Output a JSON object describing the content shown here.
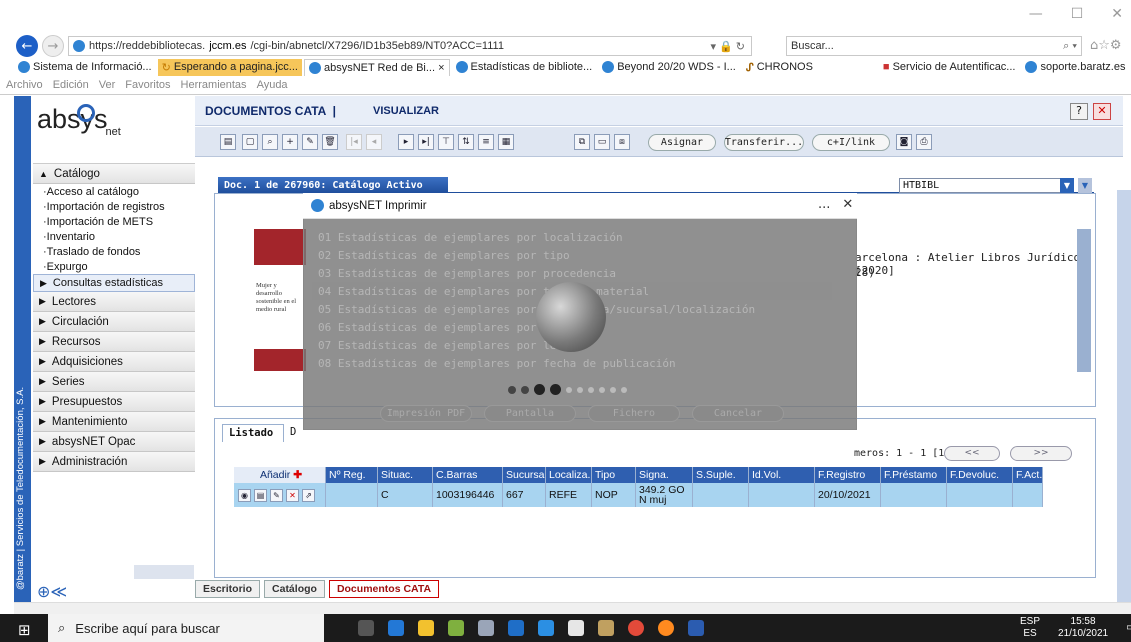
{
  "browser": {
    "url_prefix": "https://reddebibliotecas.",
    "url_domain": "jccm.es",
    "url_path": "/cgi-bin/abnetcl/X7296/ID1b35eb89/NT0?ACC=1111",
    "search_placeholder": "Buscar...",
    "tabs": [
      {
        "label": "Sistema de Informació..."
      },
      {
        "label": "Esperando a pagina.jcc..."
      },
      {
        "label": "absysNET Red de Bi... ×"
      },
      {
        "label": "Estadísticas de bibliote..."
      },
      {
        "label": "Beyond 20/20 WDS - I..."
      },
      {
        "label": "CHRONOS"
      },
      {
        "label": "Servicio de Autentificac..."
      },
      {
        "label": "soporte.baratz.es"
      }
    ],
    "menu": [
      "Archivo",
      "Edición",
      "Ver",
      "Favoritos",
      "Herramientas",
      "Ayuda"
    ]
  },
  "side_vertical_text": "@baratz | Servicios de Teledocumentación, S.A.",
  "logo": {
    "main": "absys",
    "sub": "net"
  },
  "menu": {
    "catalogo": "Catálogo",
    "catalogo_items": [
      "Acceso al catálogo",
      "Importación de registros",
      "Importación de METS",
      "Inventario",
      "Traslado de fondos",
      "Expurgo"
    ],
    "selected": "Consultas estadísticas",
    "sections": [
      "Lectores",
      "Circulación",
      "Recursos",
      "Adquisiciones",
      "Series",
      "Presupuestos",
      "Mantenimiento",
      "absysNET Opac",
      "Administración"
    ]
  },
  "header": {
    "title": "DOCUMENTOS CATA",
    "separator": "|",
    "visualizar": "VISUALIZAR",
    "help": "?",
    "close": "✕"
  },
  "toolbar": {
    "asignar": "Asignar",
    "transferir": "Transferir...",
    "link": "c+I/link"
  },
  "doc": {
    "bar": "Doc. 1 de 267960: Catálogo Activo",
    "db_select": "HTBIBL",
    "biblio_line1": "arcelona : Atelier Libros Jurídicos, [2020]",
    "biblio_line2": "28)",
    "cover_text": "Mujer y desarrollo sostenible en el medio rural"
  },
  "listado": {
    "tab": "Listado",
    "tab2": "D",
    "numeros": "meros: 1 - 1 [1]",
    "prev": "<<",
    "next": ">>",
    "add_label": "Añadir",
    "columns": [
      "Nº Reg.",
      "Situac.",
      "C.Barras",
      "Sucursal",
      "Localiza.",
      "Tipo",
      "Signa.",
      "S.Suple.",
      "Id.Vol.",
      "F.Registro",
      "F.Préstamo",
      "F.Devoluc.",
      "F.Act."
    ],
    "row": [
      "",
      "C",
      "1003196446",
      "667",
      "REFE",
      "NOP",
      "349.2 GO N muj",
      "",
      "",
      "20/10/2021",
      "",
      "",
      ""
    ]
  },
  "bottom_tabs": [
    "Escritorio",
    "Catálogo",
    "Documentos CATA"
  ],
  "modal": {
    "title": "absysNET Imprimir",
    "items": [
      "01  Estadísticas de ejemplares por localización",
      "02  Estadísticas de ejemplares por tipo",
      "03  Estadísticas de ejemplares por procedencia",
      "04  Estadísticas de ejemplares por tipo de material",
      "05  Estadísticas de ejemplares por biblioteca/sucursal/localización",
      "06  Estadísticas de ejemplares por p",
      "07  Estadísticas de ejemplares por le",
      "08  Estadísticas de ejemplares por fecha de publicación"
    ],
    "buttons": [
      "Impresión PDF",
      "Pantalla",
      "Fichero",
      "Cancelar"
    ],
    "minimize": "...",
    "close": "✕"
  },
  "taskbar": {
    "search_placeholder": "Escribe aquí para buscar",
    "lang": "ESP",
    "lang2": "ES",
    "time": "15:58",
    "date": "21/10/2021",
    "notif": "21"
  }
}
